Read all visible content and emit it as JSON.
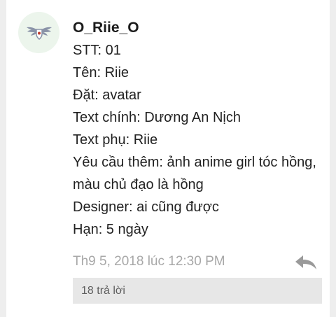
{
  "comment": {
    "avatar_icon": "winged-shield-logo-icon",
    "username": "O_Riie_O",
    "lines": [
      "STT: 01",
      "Tên: Riie",
      "Đặt: avatar",
      "Text chính: Dương An Nịch",
      "Text phụ: Riie",
      "Yêu cầu thêm: ảnh anime girl tóc hồng,",
      "màu chủ đạo là hồng",
      "Designer: ai cũng được",
      "Hạn: 5 ngày"
    ],
    "timestamp": "Th9 5, 2018 lúc 12:30 PM",
    "reply_icon": "reply-arrow-icon",
    "replies_label": "18 trả lời"
  },
  "colors": {
    "background": "#eeeeee",
    "card": "#ffffff",
    "avatar_bg": "#ecf5ec",
    "logo": "#8a93a8",
    "logo_accent": "#c0392b",
    "meta_text": "#a8a8a8",
    "reply_icon": "#9a9a9a",
    "replies_bg": "#e7e7e7"
  }
}
